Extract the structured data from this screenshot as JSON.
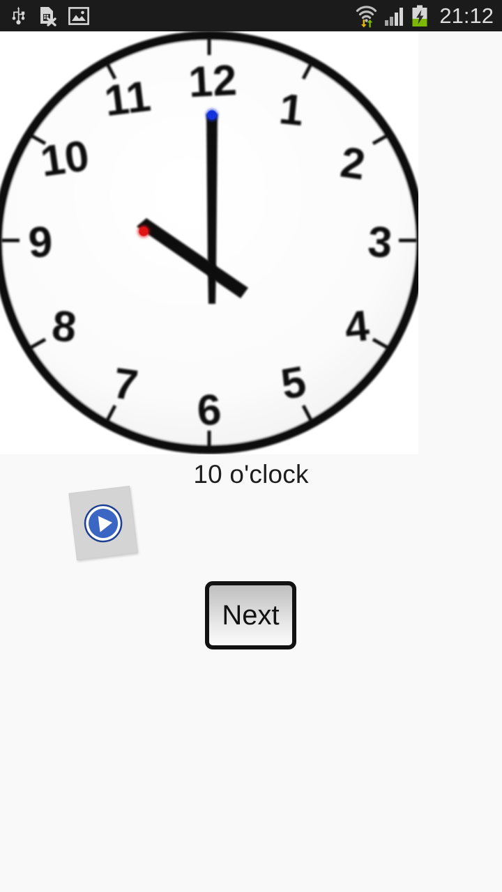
{
  "status_bar": {
    "background": "#1b1b1b",
    "time": "21:12",
    "left_icons": [
      {
        "name": "usb-icon",
        "label": "USB connected"
      },
      {
        "name": "sim-card-missing-icon",
        "label": "No SIM card"
      },
      {
        "name": "screenshot-image-icon",
        "label": "Screenshot captured"
      }
    ],
    "right_icons": [
      {
        "name": "wifi-data-transfer-icon",
        "label": "Wi-Fi with data activity",
        "down_arrow_color": "#e8b800",
        "up_arrow_color": "#7cb900"
      },
      {
        "name": "cellular-signal-icon",
        "label": "Cellular signal 4 bars",
        "bars": 4
      },
      {
        "name": "battery-charging-icon",
        "label": "Battery charging",
        "fill_color": "#7cb900"
      }
    ]
  },
  "clock_image": {
    "name": "analog-clock-illustration",
    "face_color": "#ffffff",
    "rim_color": "#111111",
    "hour_hand": {
      "points_to": 10,
      "tip_dot_color": "#e01414"
    },
    "minute_hand": {
      "points_to": 12,
      "tip_dot_color": "#1431dd"
    },
    "numerals": [
      "1",
      "2",
      "3",
      "4",
      "5",
      "6",
      "7",
      "8",
      "9",
      "10",
      "11",
      "12"
    ]
  },
  "caption": {
    "text": "10 o'clock"
  },
  "play_card": {
    "name": "play-sound-card",
    "icon_name": "play-circle-icon",
    "circle_color": "#3b66c4",
    "ring_color": "#1c3f94",
    "card_color": "#d4d4d4"
  },
  "next_button": {
    "label": "Next"
  }
}
